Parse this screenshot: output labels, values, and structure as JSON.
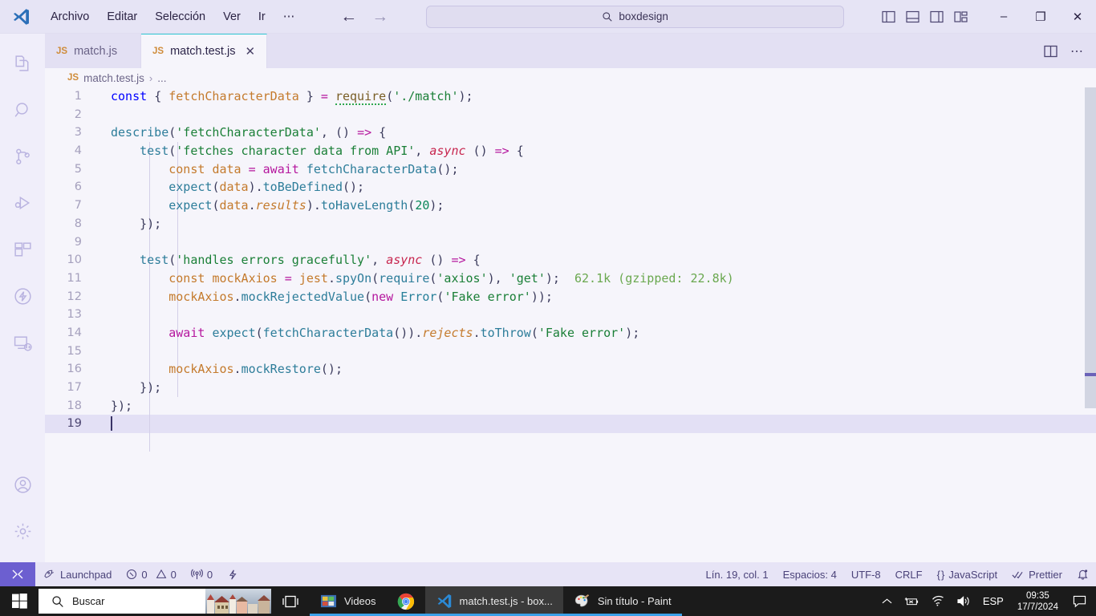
{
  "titlebar": {
    "logo_icon": "vscode-logo-icon",
    "menus": [
      "Archivo",
      "Editar",
      "Selección",
      "Ver",
      "Ir",
      "⋯"
    ],
    "nav_back_icon": "arrow-left-icon",
    "nav_forward_icon": "arrow-right-icon",
    "search": {
      "icon": "search-icon",
      "value": "boxdesign",
      "placeholder": "Buscar"
    },
    "layout_icons": [
      "toggle-primary-sidebar-icon",
      "toggle-panel-icon",
      "toggle-secondary-sidebar-icon",
      "customize-layout-icon"
    ],
    "window_buttons": {
      "minimize": "–",
      "maximize": "❐",
      "close": "✕"
    }
  },
  "activitybar": {
    "items": [
      {
        "name": "explorer-icon",
        "label": "Explorador"
      },
      {
        "name": "search-icon",
        "label": "Buscar"
      },
      {
        "name": "source-control-icon",
        "label": "Control de código fuente"
      },
      {
        "name": "run-debug-icon",
        "label": "Ejecutar y depurar"
      },
      {
        "name": "extensions-icon",
        "label": "Extensiones"
      },
      {
        "name": "lightning-icon",
        "label": "Thunder Client"
      },
      {
        "name": "remote-explorer-icon",
        "label": "Explorador remoto"
      }
    ],
    "bottom": [
      {
        "name": "account-icon",
        "label": "Cuentas"
      },
      {
        "name": "settings-gear-icon",
        "label": "Administrar"
      }
    ]
  },
  "tabs": [
    {
      "badge": "JS",
      "label": "match.js",
      "active": false,
      "closable": false
    },
    {
      "badge": "JS",
      "label": "match.test.js",
      "active": true,
      "closable": true,
      "close_icon": "close-icon"
    }
  ],
  "tab_actions": [
    {
      "name": "split-editor-icon",
      "glyph": "◫"
    },
    {
      "name": "more-actions-icon",
      "glyph": "⋯"
    }
  ],
  "breadcrumb": {
    "badge": "JS",
    "file": "match.test.js",
    "separator": "›",
    "tail": "..."
  },
  "editor": {
    "total_lines": 19,
    "active_line": 19,
    "inline_hint": "62.1k (gzipped: 22.8k)",
    "lines": [
      {
        "n": 1,
        "text": "const { fetchCharacterData } = require('./match');"
      },
      {
        "n": 2,
        "text": ""
      },
      {
        "n": 3,
        "text": "describe('fetchCharacterData', () => {"
      },
      {
        "n": 4,
        "text": "    test('fetches character data from API', async () => {"
      },
      {
        "n": 5,
        "text": "        const data = await fetchCharacterData();"
      },
      {
        "n": 6,
        "text": "        expect(data).toBeDefined();"
      },
      {
        "n": 7,
        "text": "        expect(data.results).toHaveLength(20);"
      },
      {
        "n": 8,
        "text": "    });"
      },
      {
        "n": 9,
        "text": ""
      },
      {
        "n": 10,
        "text": "    test('handles errors gracefully', async () => {"
      },
      {
        "n": 11,
        "text": "        const mockAxios = jest.spyOn(require('axios'), 'get');"
      },
      {
        "n": 12,
        "text": "        mockAxios.mockRejectedValue(new Error('Fake error'));"
      },
      {
        "n": 13,
        "text": ""
      },
      {
        "n": 14,
        "text": "        await expect(fetchCharacterData()).rejects.toThrow('Fake error');"
      },
      {
        "n": 15,
        "text": ""
      },
      {
        "n": 16,
        "text": "        mockAxios.mockRestore();"
      },
      {
        "n": 17,
        "text": "    });"
      },
      {
        "n": 18,
        "text": "});"
      },
      {
        "n": 19,
        "text": ""
      }
    ]
  },
  "statusbar": {
    "remote_icon": "remote-window-icon",
    "left": [
      {
        "name": "launchpad",
        "icon": "rocket-icon",
        "label": "Launchpad"
      },
      {
        "name": "errors",
        "icon": "error-icon",
        "label": "0"
      },
      {
        "name": "warnings",
        "icon": "warning-icon",
        "label": "0"
      },
      {
        "name": "ports",
        "icon": "radio-tower-icon",
        "label": "0"
      },
      {
        "name": "lightning",
        "icon": "lightning-icon",
        "label": ""
      }
    ],
    "right": [
      {
        "name": "cursor-position",
        "label": "Lín. 19, col. 1"
      },
      {
        "name": "indentation",
        "label": "Espacios: 4"
      },
      {
        "name": "encoding",
        "label": "UTF-8"
      },
      {
        "name": "eol",
        "label": "CRLF"
      },
      {
        "name": "language-mode",
        "label": "JavaScript",
        "icon": "braces-icon"
      },
      {
        "name": "prettier",
        "label": "Prettier",
        "icon": "check-check-icon"
      },
      {
        "name": "notifications",
        "label": "",
        "icon": "bell-dot-icon"
      }
    ]
  },
  "taskbar": {
    "start_icon": "windows-start-icon",
    "search": {
      "icon": "search-icon",
      "placeholder": "Buscar"
    },
    "task_view_icon": "task-view-icon",
    "buttons": [
      {
        "name": "videos",
        "label": "Videos",
        "icon": "folder-videos-icon",
        "active": false,
        "running": true
      },
      {
        "name": "chrome",
        "label": "",
        "icon": "chrome-icon",
        "active": false,
        "running": true
      },
      {
        "name": "vscode",
        "label": "match.test.js - box...",
        "icon": "vscode-icon",
        "active": true,
        "running": true
      },
      {
        "name": "paint",
        "label": "Sin título - Paint",
        "icon": "paint-icon",
        "active": false,
        "running": true
      }
    ],
    "tray": {
      "chevron_icon": "chevron-up-icon",
      "icons": [
        "battery-icon",
        "wifi-icon",
        "volume-icon"
      ],
      "language": "ESP",
      "time": "09:35",
      "date": "17/7/2024",
      "notification_icon": "notification-icon"
    }
  }
}
